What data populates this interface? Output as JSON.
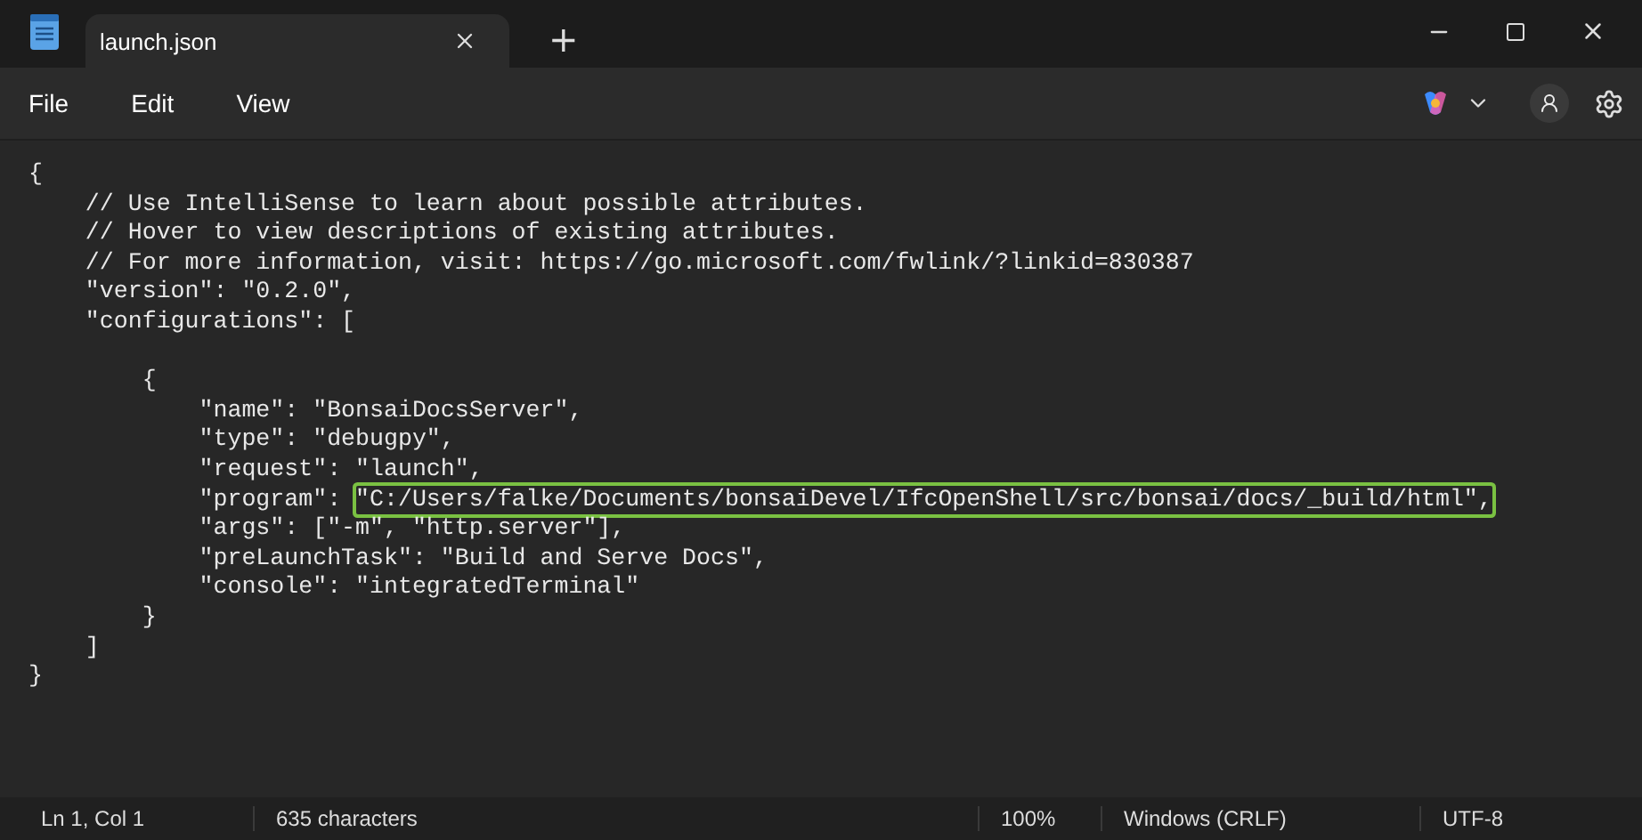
{
  "window": {
    "tab_title": "launch.json",
    "new_tab": "+"
  },
  "menu": [
    "File",
    "Edit",
    "View"
  ],
  "editor": {
    "lines": [
      {
        "text": "{"
      },
      {
        "text": "    // Use IntelliSense to learn about possible attributes."
      },
      {
        "text": "    // Hover to view descriptions of existing attributes."
      },
      {
        "text": "    // For more information, visit: https://go.microsoft.com/fwlink/?linkid=830387"
      },
      {
        "text": "    \"version\": \"0.2.0\","
      },
      {
        "text": "    \"configurations\": ["
      },
      {
        "text": "        {",
        "blank_line_before": true
      },
      {
        "text": "            \"name\": \"BonsaiDocsServer\","
      },
      {
        "text": "            \"type\": \"debugpy\","
      },
      {
        "text": "            \"request\": \"launch\","
      },
      {
        "text": "            \"program\": ",
        "highlighted": "\"C:/Users/falke/Documents/bonsaiDevel/IfcOpenShell/src/bonsai/docs/_build/html\","
      },
      {
        "text": "            \"args\": [\"-m\", \"http.server\"],"
      },
      {
        "text": "            \"preLaunchTask\": \"Build and Serve Docs\","
      },
      {
        "text": "            \"console\": \"integratedTerminal\""
      },
      {
        "text": "        }"
      },
      {
        "text": "    ]"
      },
      {
        "text": "}"
      }
    ]
  },
  "status_bar": {
    "position": "Ln 1, Col 1",
    "characters": "635 characters",
    "zoom": "100%",
    "line_ending": "Windows (CRLF)",
    "encoding": "UTF-8"
  }
}
